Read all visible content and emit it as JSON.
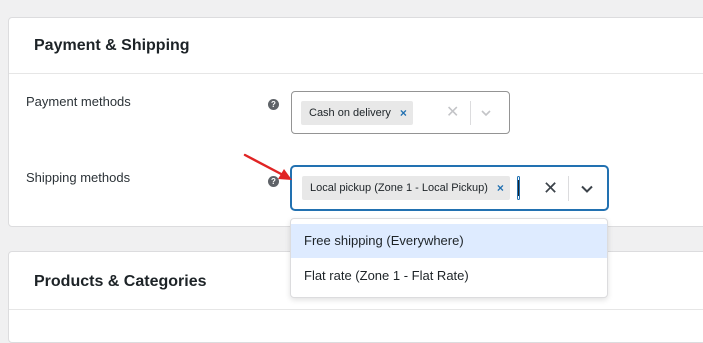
{
  "payment_shipping": {
    "title": "Payment & Shipping",
    "payment_methods": {
      "label": "Payment methods",
      "help_glyph": "?",
      "selected": [
        {
          "label": "Cash on delivery",
          "remove": "×"
        }
      ],
      "clear_glyph": "✕"
    },
    "shipping_methods": {
      "label": "Shipping methods",
      "help_glyph": "?",
      "selected": [
        {
          "label": "Local pickup (Zone 1 - Local Pickup)",
          "remove": "×"
        }
      ],
      "clear_glyph": "✕",
      "dropdown_open": true,
      "options": [
        {
          "label": "Free shipping (Everywhere)",
          "highlighted": true
        },
        {
          "label": "Flat rate (Zone 1 - Flat Rate)",
          "highlighted": false
        }
      ]
    }
  },
  "products_categories": {
    "title": "Products & Categories"
  },
  "colors": {
    "accent": "#2271b1",
    "arrow": "#e02424",
    "highlight": "#deebff",
    "tag_bg": "#e8e8e8"
  },
  "icons": {
    "help": "question-circle-icon",
    "clear": "close-icon",
    "dropdown": "chevron-down-icon",
    "annotation": "red-arrow-icon"
  }
}
